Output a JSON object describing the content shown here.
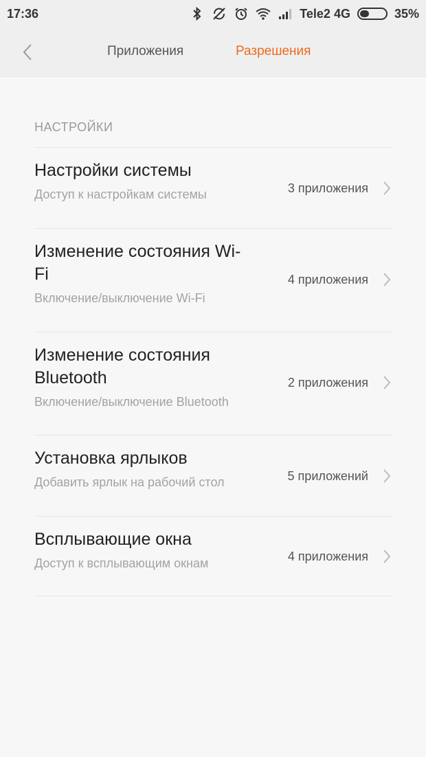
{
  "status_bar": {
    "time": "17:36",
    "carrier": "Tele2 4G",
    "battery_percent": "35%",
    "battery_level": 0.35,
    "icons": [
      "bluetooth-icon",
      "sync-off-icon",
      "alarm-icon",
      "wifi-icon",
      "signal-icon",
      "battery-icon"
    ]
  },
  "nav": {
    "tabs": [
      {
        "label": "Приложения",
        "active": false
      },
      {
        "label": "Разрешения",
        "active": true
      }
    ],
    "active_color": "#ee6a1e"
  },
  "section": {
    "header": "НАСТРОЙКИ"
  },
  "items": [
    {
      "title": "Настройки системы",
      "subtitle": "Доступ к настройкам системы",
      "count": "3 приложения"
    },
    {
      "title": "Изменение состояния Wi-Fi",
      "subtitle": "Включение/выключение Wi-Fi",
      "count": "4 приложения"
    },
    {
      "title": "Изменение состояния Bluetooth",
      "subtitle": "Включение/выключение Bluetooth",
      "count": "2 приложения"
    },
    {
      "title": "Установка ярлыков",
      "subtitle": "Добавить ярлык на рабочий стол",
      "count": "5 приложений"
    },
    {
      "title": "Всплывающие окна",
      "subtitle": "Доступ к всплывающим окнам",
      "count": "4 приложения"
    }
  ]
}
